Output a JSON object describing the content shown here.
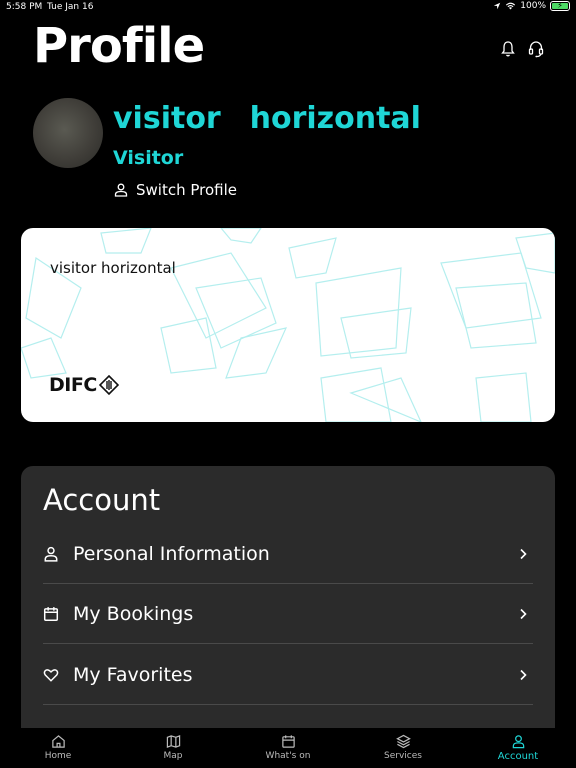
{
  "status_bar": {
    "time": "5:58 PM",
    "date": "Tue Jan 16",
    "battery": "100%",
    "battery_level": 1.0
  },
  "header": {
    "title": "Profile",
    "icons": [
      "bell-icon",
      "support-headset-icon"
    ]
  },
  "profile": {
    "name": "visitor  horizontal",
    "role": "Visitor",
    "switch_label": "Switch Profile"
  },
  "card": {
    "holder_name": "visitor horizontal",
    "logo_text": "DIFC"
  },
  "account": {
    "title": "Account",
    "items": [
      {
        "label": "Personal Information",
        "icon": "person-icon"
      },
      {
        "label": "My Bookings",
        "icon": "calendar-icon"
      },
      {
        "label": "My Favorites",
        "icon": "heart-icon"
      }
    ]
  },
  "tabs": [
    {
      "label": "Home",
      "icon": "home-icon"
    },
    {
      "label": "Map",
      "icon": "map-icon"
    },
    {
      "label": "What's on",
      "icon": "calendar-icon"
    },
    {
      "label": "Services",
      "icon": "layers-icon"
    },
    {
      "label": "Account",
      "icon": "person-icon",
      "active": true
    }
  ],
  "colors": {
    "accent": "#1fd6d6",
    "background": "#000000",
    "panel": "#2b2b2b",
    "card": "#ffffff"
  }
}
